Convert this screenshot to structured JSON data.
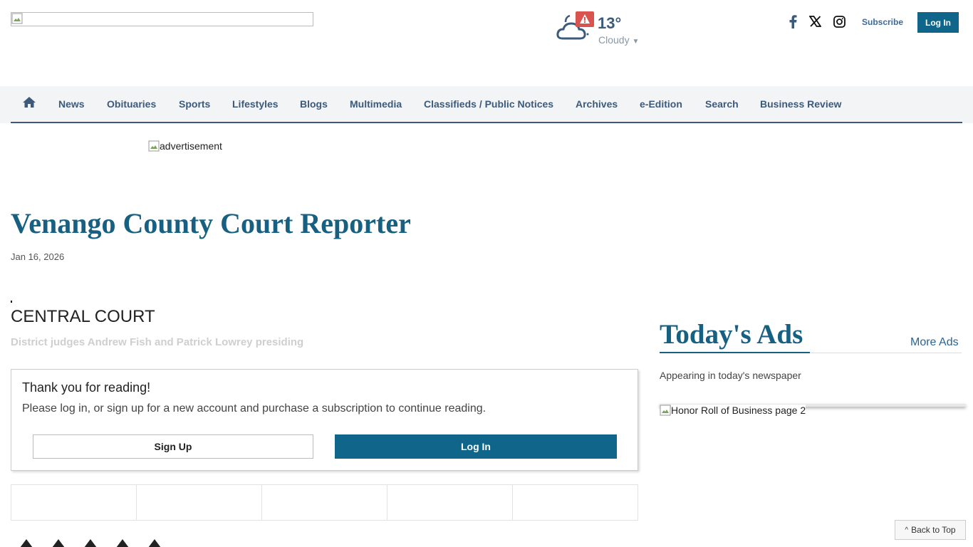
{
  "header": {
    "logo_alt": "",
    "weather": {
      "temperature": "13°",
      "condition": "Cloudy",
      "alert_icon": "warning-icon",
      "cloud_icon": "cloud-night-icon"
    },
    "social": [
      "facebook-icon",
      "x-icon",
      "instagram-icon"
    ],
    "subscribe_label": "Subscribe",
    "login_label": "Log In"
  },
  "nav": {
    "home_icon": "home-icon",
    "items": [
      "News",
      "Obituaries",
      "Sports",
      "Lifestyles",
      "Blogs",
      "Multimedia",
      "Classifieds / Public Notices",
      "Archives",
      "e-Edition",
      "Search",
      "Business Review"
    ]
  },
  "ad": {
    "alt": "advertisement"
  },
  "article": {
    "title": "Venango County Court Reporter",
    "date": "Jan 16, 2026",
    "section_heading": "CENTRAL COURT",
    "subheading": "District judges Andrew Fish and Patrick Lowrey presiding"
  },
  "paywall": {
    "title": "Thank you for reading!",
    "message": "Please log in, or sign up for a new account and purchase a subscription to continue reading.",
    "signup_label": "Sign Up",
    "login_label": "Log In"
  },
  "sidebar": {
    "title": "Today's Ads",
    "more_label": "More Ads",
    "subtitle": "Appearing in today's newspaper",
    "ad_alt": "Honor Roll of Business page 2"
  },
  "back_to_top": "Back to Top",
  "colors": {
    "brand": "#176081",
    "button": "#10668a",
    "nav_text": "#3d5a7a",
    "alert": "#d9534f"
  }
}
